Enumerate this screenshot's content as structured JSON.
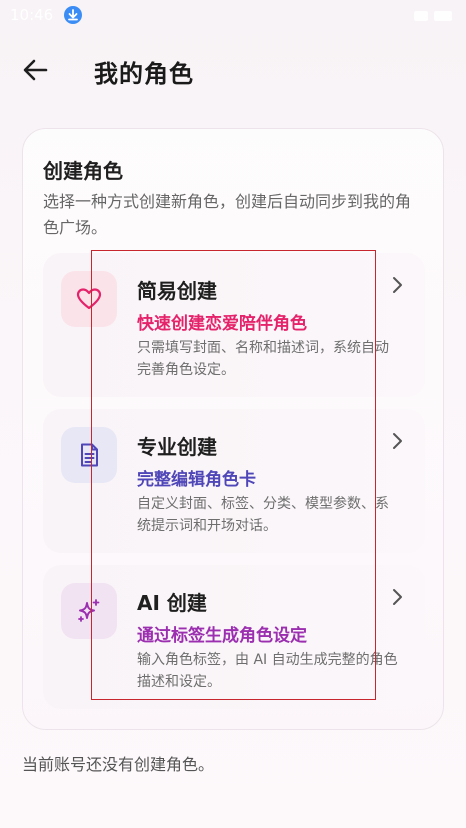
{
  "status_bar": {
    "time": "10:46"
  },
  "header": {
    "title": "我的角色"
  },
  "panel": {
    "title": "创建角色",
    "description": "选择一种方式创建新角色，创建后自动同步到我的角色广场。",
    "options": [
      {
        "title": "简易创建",
        "subtitle": "快速创建恋爱陪伴角色",
        "description": "只需填写封面、名称和描述词，系统自动完善角色设定。",
        "icon": "heart-icon",
        "accent_color": "#e5236b",
        "icon_bg": "#fbe3ea"
      },
      {
        "title": "专业创建",
        "subtitle": "完整编辑角色卡",
        "description": "自定义封面、标签、分类、模型参数、系统提示词和开场对话。",
        "icon": "document-icon",
        "accent_color": "#4f46b8",
        "icon_bg": "#e8e7f6"
      },
      {
        "title": "AI 创建",
        "subtitle": "通过标签生成角色设定",
        "description": "输入角色标签，由 AI 自动生成完整的角色描述和设定。",
        "icon": "sparkle-icon",
        "accent_color": "#9b2fb0",
        "icon_bg": "#f2e3f3"
      }
    ]
  },
  "footer": {
    "note": "当前账号还没有创建角色。"
  }
}
